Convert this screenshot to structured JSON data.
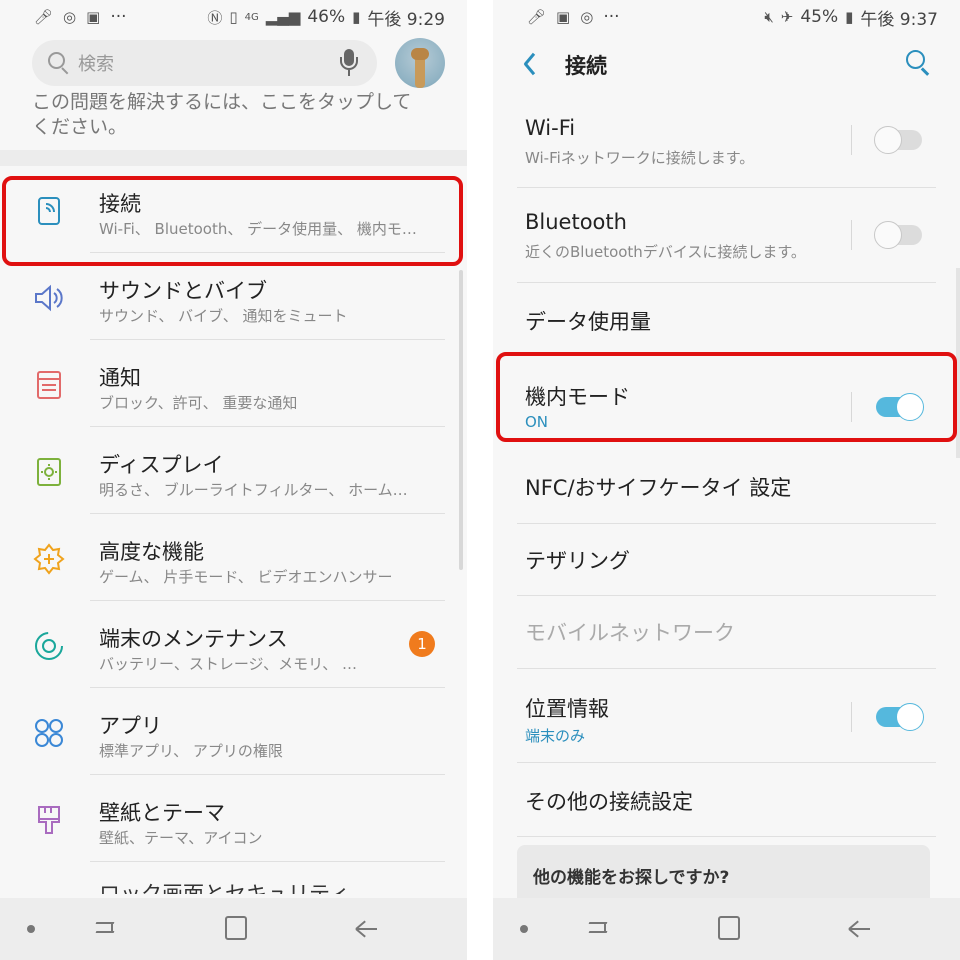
{
  "left": {
    "status": {
      "icons_left": [
        "mic-icon",
        "data-saver-icon",
        "image-icon",
        "more-icon"
      ],
      "dots": "···",
      "icons_right": [
        "nfc-icon",
        "vibrate-icon",
        "4g-icon",
        "signal-icon"
      ],
      "network": "4G",
      "battery": "46%",
      "time": "午後 9:29"
    },
    "search": {
      "placeholder": "検索"
    },
    "banner_text": "この問題を解決するには、ここをタップしてください。",
    "menu": [
      {
        "title": "接続",
        "subtitle": "Wi-Fi、 Bluetooth、 データ使用量、 機内モ…",
        "icon": "connections-icon",
        "color": "#2b8fbd"
      },
      {
        "title": "サウンドとバイブ",
        "subtitle": "サウンド、 バイブ、 通知をミュート",
        "icon": "speaker-icon",
        "color": "#5b77c9"
      },
      {
        "title": "通知",
        "subtitle": "ブロック、許可、 重要な通知",
        "icon": "notification-icon",
        "color": "#e26a6a"
      },
      {
        "title": "ディスプレイ",
        "subtitle": "明るさ、 ブルーライトフィルター、 ホーム…",
        "icon": "display-icon",
        "color": "#7db13c"
      },
      {
        "title": "高度な機能",
        "subtitle": "ゲーム、 片手モード、 ビデオエンハンサー",
        "icon": "advanced-features-icon",
        "color": "#f0a31d"
      },
      {
        "title": "端末のメンテナンス",
        "subtitle": "バッテリー、ストレージ、メモリ、 …",
        "icon": "maintenance-icon",
        "color": "#1aa79b",
        "badge": "1"
      },
      {
        "title": "アプリ",
        "subtitle": "標準アプリ、 アプリの権限",
        "icon": "apps-icon",
        "color": "#3b88d6"
      },
      {
        "title": "壁紙とテーマ",
        "subtitle": "壁紙、テーマ、アイコン",
        "icon": "theme-brush-icon",
        "color": "#a96bbf"
      }
    ],
    "cut_row_title": "ロック画面とセキュリティ"
  },
  "right": {
    "status": {
      "icons_left": [
        "mic-icon",
        "image-icon",
        "data-saver-icon",
        "more-icon"
      ],
      "dots": "···",
      "icons_right": [
        "mute-icon",
        "airplane-icon"
      ],
      "battery": "45%",
      "time": "午後 9:37"
    },
    "app_bar": {
      "title": "接続"
    },
    "settings": [
      {
        "title": "Wi-Fi",
        "subtitle": "Wi-Fiネットワークに接続します。",
        "toggle": "off"
      },
      {
        "title": "Bluetooth",
        "subtitle": "近くのBluetoothデバイスに接続します。",
        "toggle": "off"
      },
      {
        "title": "データ使用量"
      },
      {
        "title": "機内モード",
        "subtitle": "ON",
        "toggle": "on"
      },
      {
        "title": "NFC/おサイフケータイ 設定"
      },
      {
        "title": "テザリング"
      },
      {
        "title": "モバイルネットワーク",
        "disabled": true
      },
      {
        "title": "位置情報",
        "subtitle": "端末のみ",
        "toggle": "on"
      },
      {
        "title": "その他の接続設定"
      }
    ],
    "more_card_title": "他の機能をお探しですか?"
  },
  "colors": {
    "accent": "#2b8fbd",
    "highlight": "#e01010",
    "badge": "#f07b1d",
    "toggle_on": "#55b8dd"
  }
}
